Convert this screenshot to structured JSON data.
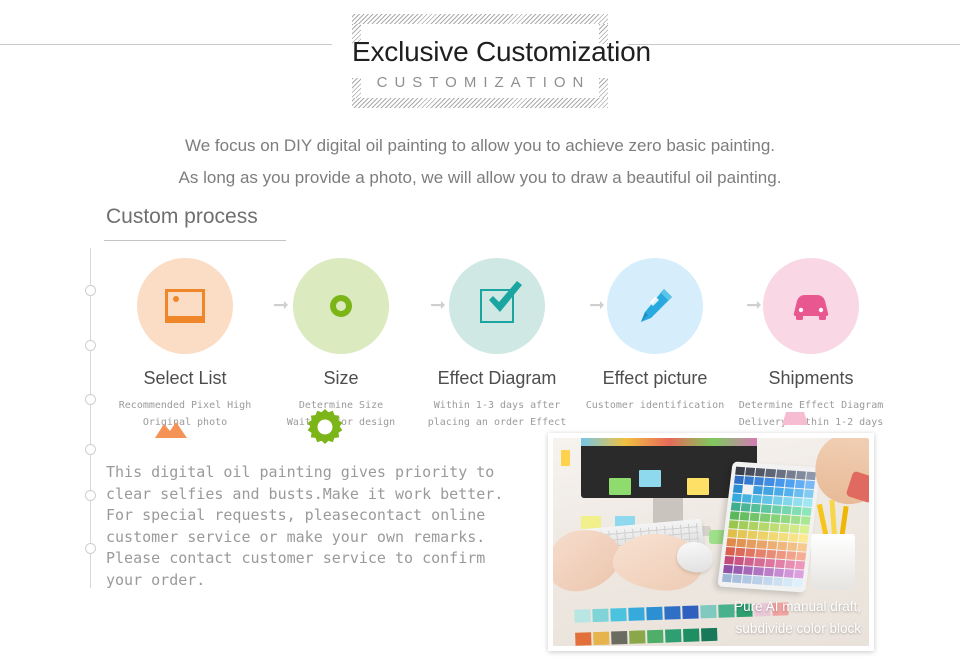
{
  "header": {
    "title": "Exclusive Customization",
    "subtitle": "CUSTOMIZATION"
  },
  "intro": {
    "line1": "We focus on DIY digital oil painting to allow you to achieve zero basic painting.",
    "line2": "As long as you provide a photo, we will allow you to draw a beautiful oil painting."
  },
  "section": {
    "title": "Custom process"
  },
  "steps": [
    {
      "label": "Select List",
      "desc_line1": "Recommended Pixel High",
      "desc_line2": "Original photo",
      "icon": "photo-icon",
      "circle_color": "#fbdcc4",
      "icon_color": "#f0862a"
    },
    {
      "label": "Size",
      "desc_line1": "Determine Size",
      "desc_line2": "Waiting for design",
      "icon": "ring-icon",
      "circle_color": "#dbeabf",
      "icon_color": "#7cb518"
    },
    {
      "label": "Effect Diagram",
      "desc_line1": "Within 1-3 days after",
      "desc_line2": "placing an order Effect",
      "icon": "checkbox-icon",
      "circle_color": "#cfe8e4",
      "icon_color": "#1aa5a0"
    },
    {
      "label": "Effect picture",
      "desc_line1": "Customer identification",
      "desc_line2": "",
      "icon": "pen-icon",
      "circle_color": "#d6eefb",
      "icon_color": "#28a9e0"
    },
    {
      "label": "Shipments",
      "desc_line1": "Determine Effect Diagram",
      "desc_line2": "Delivery within 1-2 days",
      "icon": "car-icon",
      "circle_color": "#f9d7e5",
      "icon_color": "#e8578f"
    }
  ],
  "arrows": [
    "arrow-1",
    "arrow-2",
    "arrow-3",
    "arrow-4"
  ],
  "body": {
    "line1": "This digital oil painting gives priority to",
    "line2": "clear selfies and busts.Make it work better.",
    "line3": "For special requests, pleasecontact online",
    "line4": "customer service or make your own remarks.",
    "line5": "Please contact customer service to confirm",
    "line6": "your order."
  },
  "photo": {
    "caption_line1": "Pure AI manual draft,",
    "caption_line2": "subdivide color block"
  },
  "colors": {
    "orange": "#f0862a",
    "green": "#7cb518",
    "teal": "#1aa5a0",
    "blue": "#28a9e0",
    "pink": "#e8578f",
    "text_gray": "#7d7d7d",
    "rule_gray": "#c9c9c9"
  }
}
